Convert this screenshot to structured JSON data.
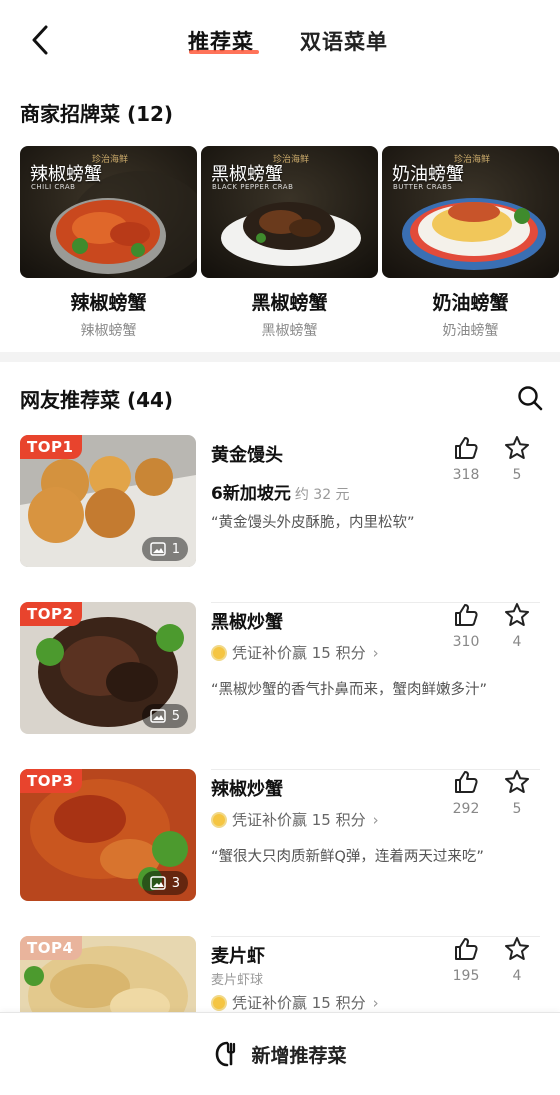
{
  "header": {
    "tab_active": "推荐菜",
    "tab_bilingual": "双语菜单"
  },
  "signature": {
    "title": "商家招牌菜 (12)",
    "dishes": [
      {
        "name": "辣椒螃蟹",
        "sub": "辣椒螃蟹",
        "overlay_cn": "辣椒螃蟹",
        "overlay_en": "CHILI CRAB",
        "logo": "珍治海鲜"
      },
      {
        "name": "黑椒螃蟹",
        "sub": "黑椒螃蟹",
        "overlay_cn": "黑椒螃蟹",
        "overlay_en": "BLACK PEPPER CRAB",
        "logo": "珍治海鲜"
      },
      {
        "name": "奶油螃蟹",
        "sub": "奶油螃蟹",
        "overlay_cn": "奶油螃蟹",
        "overlay_en": "BUTTER CRABS",
        "logo": "珍治海鲜"
      }
    ]
  },
  "recommended": {
    "title": "网友推荐菜 (44)",
    "items": [
      {
        "rank": "TOP1",
        "name": "黄金馒头",
        "price": "6新加坡元",
        "price_approx": "约 32 元",
        "quote": "“黄金馒头外皮酥脆，内里松软”",
        "likes": "318",
        "stars": "5",
        "photos": "1"
      },
      {
        "rank": "TOP2",
        "name": "黑椒炒蟹",
        "reward": "凭证补价赢 15 积分",
        "quote": "“黑椒炒蟹的香气扑鼻而来，蟹肉鲜嫩多汁”",
        "likes": "310",
        "stars": "4",
        "photos": "5"
      },
      {
        "rank": "TOP3",
        "name": "辣椒炒蟹",
        "reward": "凭证补价赢 15 积分",
        "quote": "“蟹很大只肉质新鲜Q弹，连着两天过来吃”",
        "likes": "292",
        "stars": "5",
        "photos": "3"
      },
      {
        "rank": "TOP4",
        "name": "麦片虾",
        "sub": "麦片虾球",
        "reward": "凭证补价赢 15 积分",
        "likes": "195",
        "stars": "4"
      }
    ]
  },
  "bottom": {
    "add_label": "新增推荐菜"
  },
  "colors": {
    "accent": "#e8442d",
    "underline": "#ff5a3c",
    "coin": "#f5c542"
  }
}
